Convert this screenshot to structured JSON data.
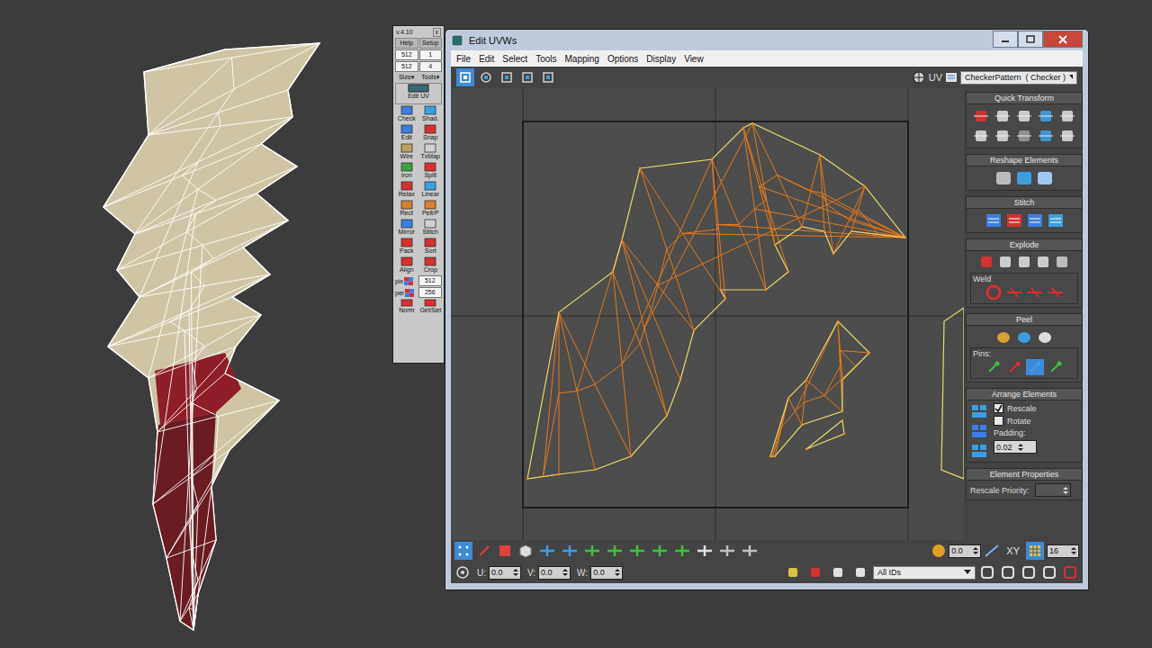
{
  "textools": {
    "version": "v.4.10",
    "close": "x",
    "header_buttons": [
      "Help",
      "Setup"
    ],
    "fields": [
      [
        "512",
        "1"
      ],
      [
        "512",
        "4"
      ]
    ],
    "menus": [
      "Size▾",
      "Tools▾"
    ],
    "wide_button": "Edit UV",
    "tools": [
      [
        "Check",
        "Shad."
      ],
      [
        "Edit",
        "Snap"
      ],
      [
        "Wire",
        "TxMap"
      ],
      [
        "Iron",
        "Split"
      ],
      [
        "Relax",
        "Linear"
      ],
      [
        "Rect",
        "Pelt/P"
      ],
      [
        "Mirror",
        "Stitch"
      ],
      [
        "Pack",
        "Sort"
      ],
      [
        "Align",
        "Crop"
      ]
    ],
    "settings": [
      {
        "label": "pix",
        "value": "512"
      },
      {
        "label": "per",
        "value": "256"
      }
    ],
    "footer": [
      "Norm",
      "Get/Set"
    ]
  },
  "window": {
    "title": "Edit UVWs"
  },
  "menu": [
    "File",
    "Edit",
    "Select",
    "Tools",
    "Mapping",
    "Options",
    "Display",
    "View"
  ],
  "toolbar": {
    "tools": [
      {
        "selected": true
      },
      {
        "selected": false
      },
      {
        "selected": false
      },
      {
        "selected": false
      },
      {
        "selected": false
      }
    ],
    "uv_label": "UV",
    "texture": "CheckerPattern  ( Checker )"
  },
  "panel": {
    "quick_transform": "Quick Transform",
    "reshape": "Reshape Elements",
    "stitch": "Stitch",
    "explode": "Explode",
    "weld": "Weld",
    "peel": "Peel",
    "pins_label": "Pins:",
    "pins": [
      {
        "selected": false
      },
      {
        "selected": false
      },
      {
        "selected": true
      },
      {
        "selected": false
      }
    ],
    "arrange": "Arrange Elements",
    "options": [
      {
        "label": "Rescale",
        "checked": true
      },
      {
        "label": "Rotate",
        "checked": false
      }
    ],
    "padding_label": "Padding:",
    "padding": "0.02",
    "element_properties": "Element Properties",
    "rescale_priority_label": "Rescale Priority:"
  },
  "bottom": {
    "selection_modes": [
      {
        "selected": true
      },
      {
        "selected": false
      },
      {
        "selected": false
      }
    ],
    "angle": "0.0",
    "plane": "XY",
    "grid_snap": {
      "selected": true
    },
    "grid": "16",
    "coords": [
      {
        "label": "U:",
        "value": "0.0"
      },
      {
        "label": "V:",
        "value": "0.0"
      },
      {
        "label": "W:",
        "value": "0.0"
      }
    ],
    "ids": "All IDs"
  }
}
